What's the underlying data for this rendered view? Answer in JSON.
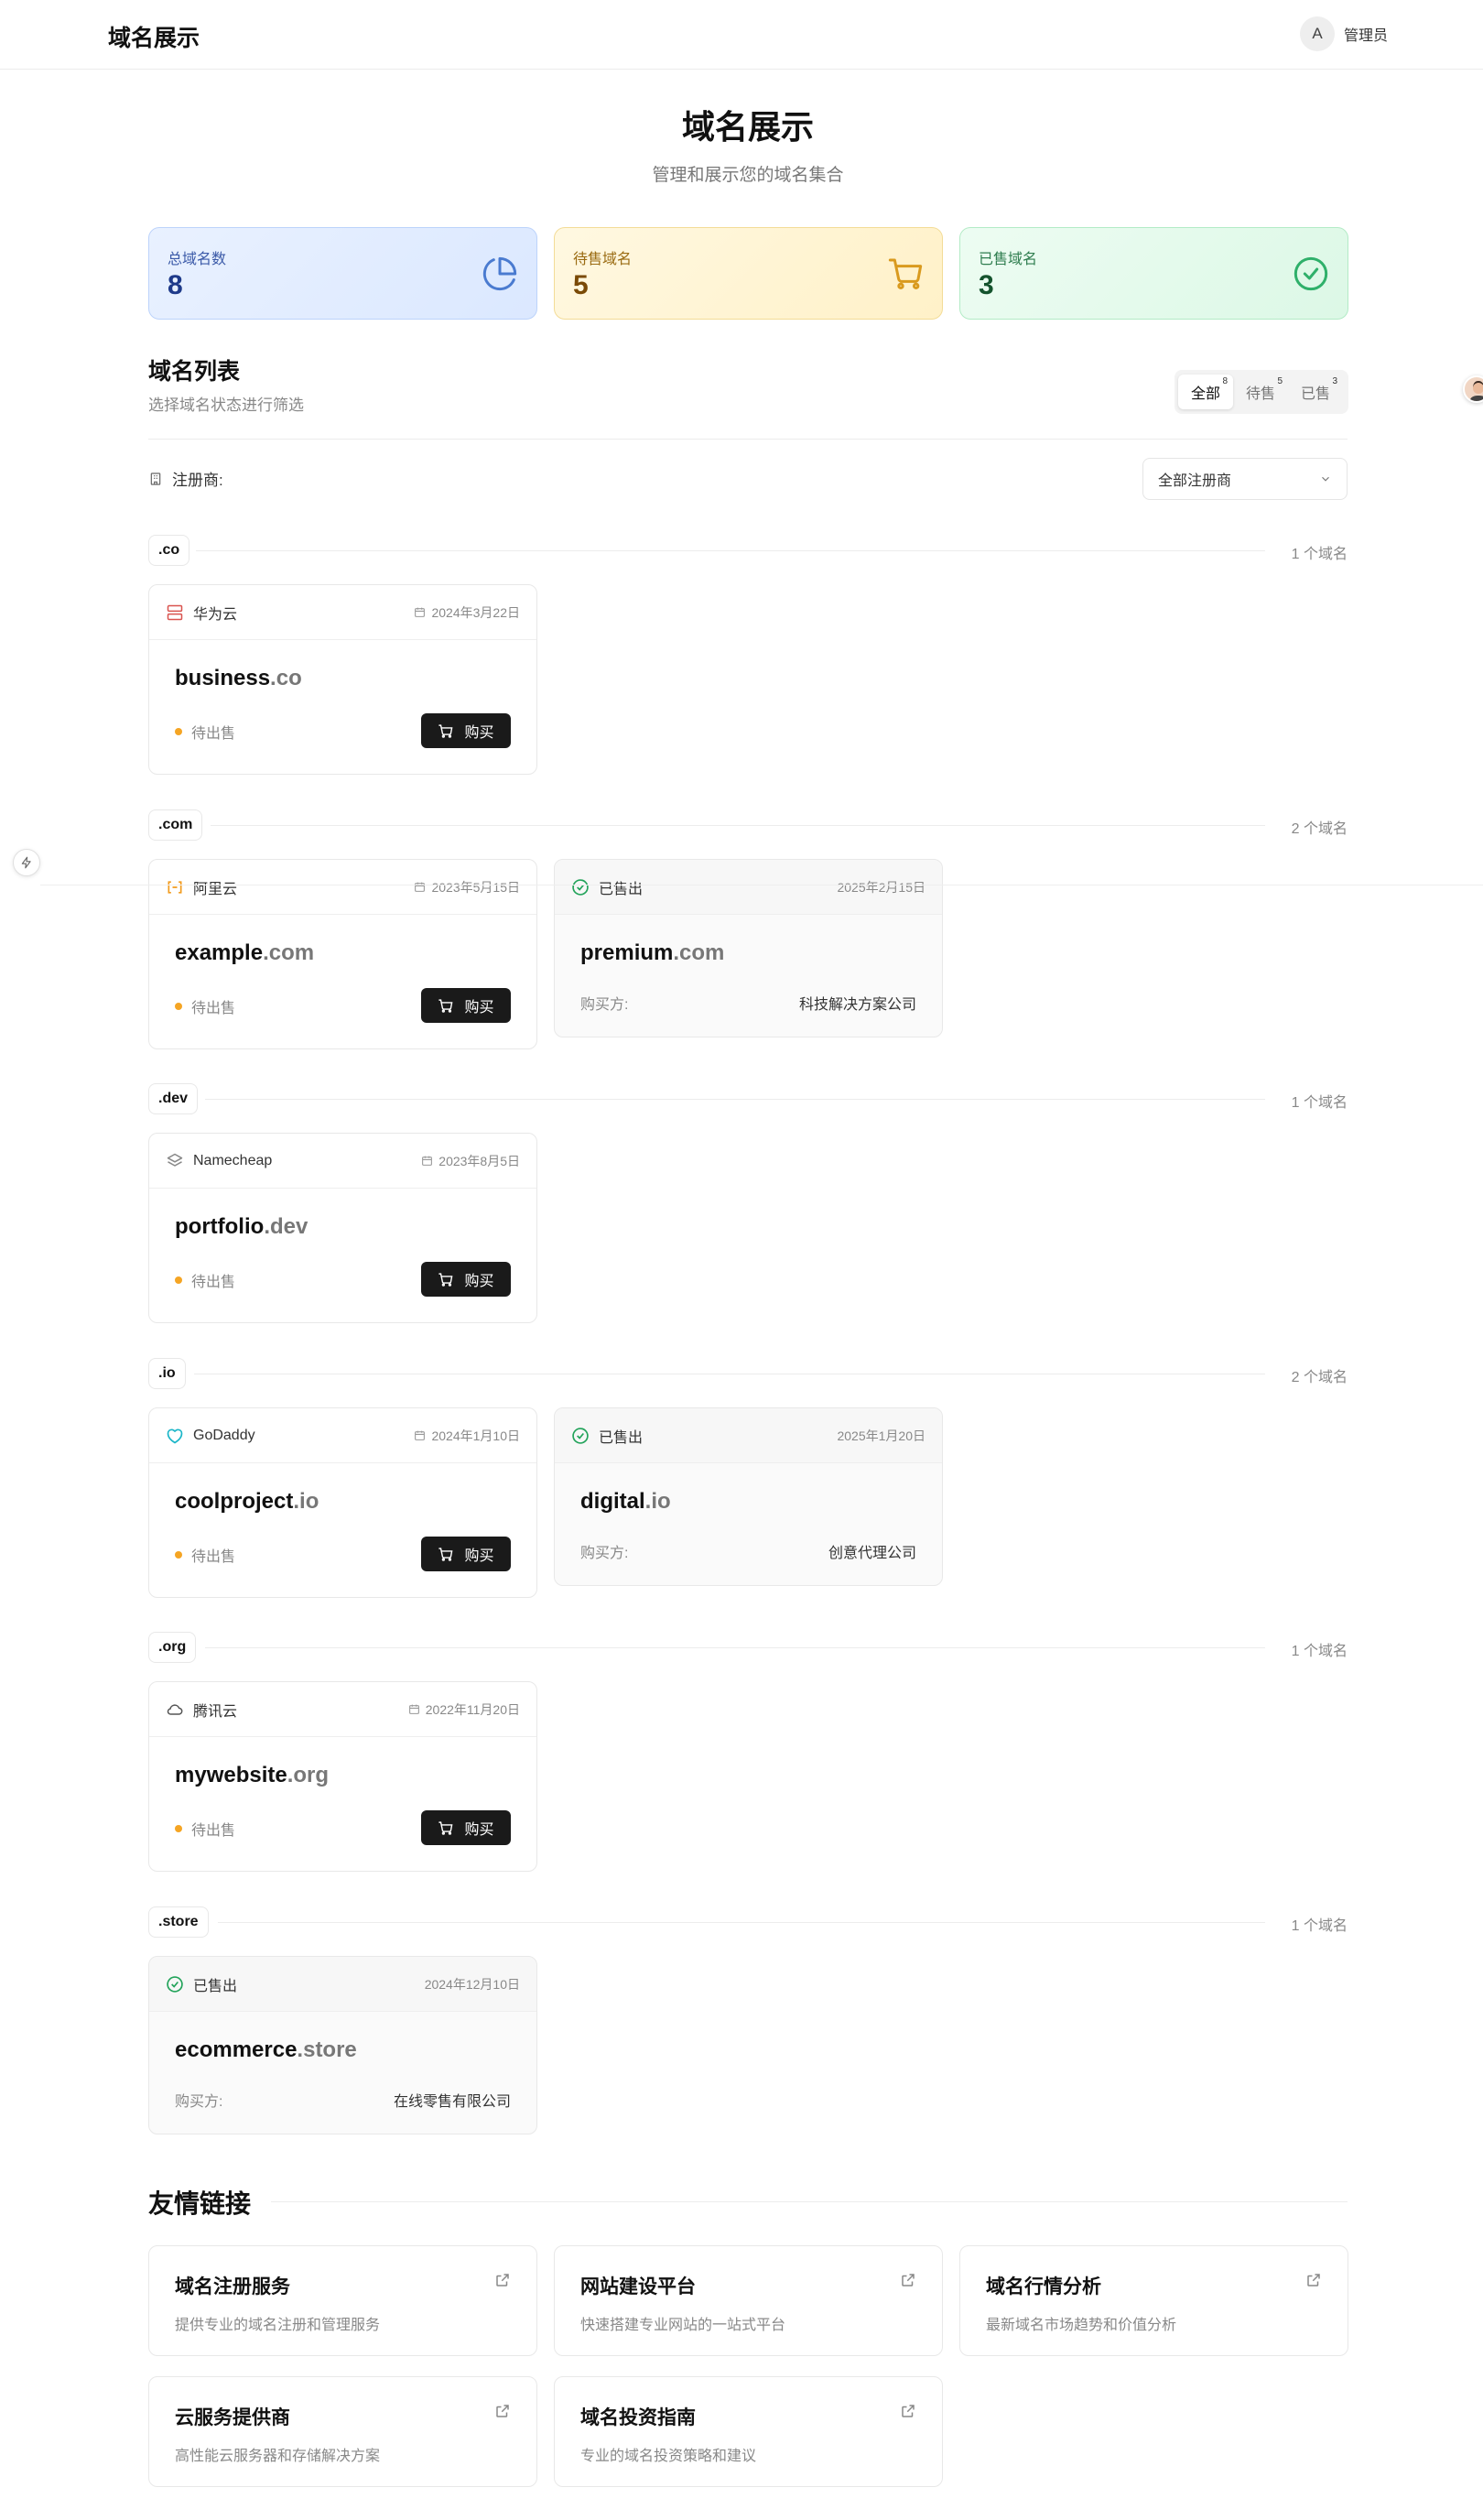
{
  "header": {
    "brand": "域名展示",
    "avatar_letter": "A",
    "user_name": "管理员"
  },
  "hero": {
    "title": "域名展示",
    "subtitle": "管理和展示您的域名集合"
  },
  "stats": [
    {
      "label": "总域名数",
      "value": "8",
      "icon": "pie-chart-icon"
    },
    {
      "label": "待售域名",
      "value": "5",
      "icon": "cart-icon"
    },
    {
      "label": "已售域名",
      "value": "3",
      "icon": "check-circle-icon"
    }
  ],
  "list": {
    "title": "域名列表",
    "subtitle": "选择域名状态进行筛选",
    "tabs": [
      {
        "label": "全部",
        "badge": "8"
      },
      {
        "label": "待售",
        "badge": "5"
      },
      {
        "label": "已售",
        "badge": "3"
      }
    ],
    "registrar_label": "注册商:",
    "registrar_select": "全部注册商"
  },
  "groups": [
    {
      "tld": ".co",
      "count": "1 个域名"
    },
    {
      "tld": ".com",
      "count": "2 个域名"
    },
    {
      "tld": ".dev",
      "count": "1 个域名"
    },
    {
      "tld": ".io",
      "count": "2 个域名"
    },
    {
      "tld": ".org",
      "count": "1 个域名"
    },
    {
      "tld": ".store",
      "count": "1 个域名"
    }
  ],
  "cards": [
    {
      "registrar": "华为云",
      "date": "2024年3月22日",
      "name": "business",
      "tld": ".co",
      "status": "待出售",
      "buy": "购买"
    },
    {
      "registrar": "阿里云",
      "date": "2023年5月15日",
      "name": "example",
      "tld": ".com",
      "status": "待出售",
      "buy": "购买"
    },
    {
      "registrar": "已售出",
      "date": "2025年2月15日",
      "name": "premium",
      "tld": ".com",
      "buyer_label": "购买方:",
      "buyer": "科技解决方案公司"
    },
    {
      "registrar": "Namecheap",
      "date": "2023年8月5日",
      "name": "portfolio",
      "tld": ".dev",
      "status": "待出售",
      "buy": "购买"
    },
    {
      "registrar": "GoDaddy",
      "date": "2024年1月10日",
      "name": "coolproject",
      "tld": ".io",
      "status": "待出售",
      "buy": "购买"
    },
    {
      "registrar": "已售出",
      "date": "2025年1月20日",
      "name": "digital",
      "tld": ".io",
      "buyer_label": "购买方:",
      "buyer": "创意代理公司"
    },
    {
      "registrar": "腾讯云",
      "date": "2022年11月20日",
      "name": "mywebsite",
      "tld": ".org",
      "status": "待出售",
      "buy": "购买"
    },
    {
      "registrar": "已售出",
      "date": "2024年12月10日",
      "name": "ecommerce",
      "tld": ".store",
      "buyer_label": "购买方:",
      "buyer": "在线零售有限公司"
    }
  ],
  "links": {
    "title": "友情链接",
    "items": [
      {
        "title": "域名注册服务",
        "desc": "提供专业的域名注册和管理服务"
      },
      {
        "title": "网站建设平台",
        "desc": "快速搭建专业网站的一站式平台"
      },
      {
        "title": "域名行情分析",
        "desc": "最新域名市场趋势和价值分析"
      },
      {
        "title": "云服务提供商",
        "desc": "高性能云服务器和存储解决方案"
      },
      {
        "title": "域名投资指南",
        "desc": "专业的域名投资策略和建议"
      }
    ]
  },
  "colors": {
    "pending_dot": "#f5a524",
    "sold_green": "#22a35a",
    "buy_button": "#1a1a1a"
  }
}
